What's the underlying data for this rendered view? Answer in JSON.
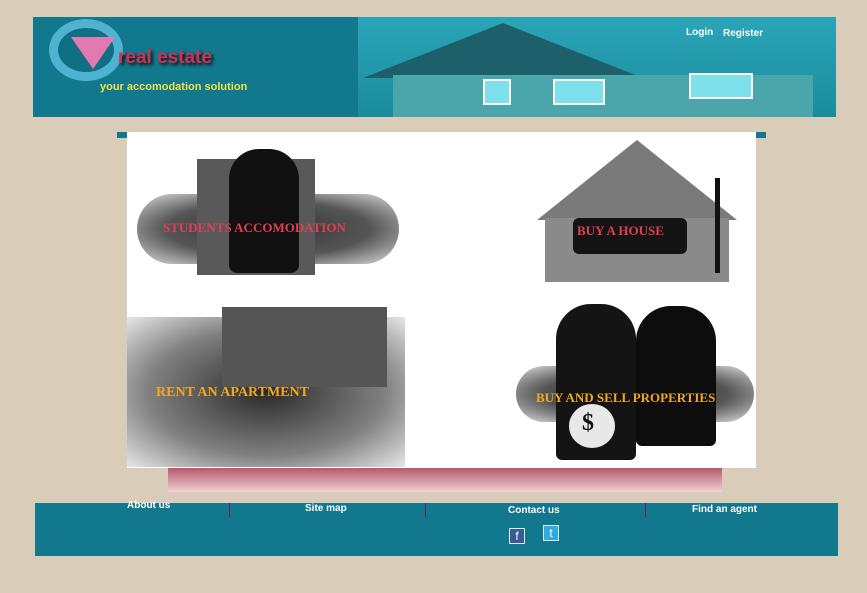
{
  "header": {
    "brand": "real estate",
    "tagline": "your accomodation solution",
    "login": "Login",
    "register": "Register"
  },
  "tiles": [
    {
      "label": "STUDENTS ACCOMODATION"
    },
    {
      "label": "BUY A HOUSE"
    },
    {
      "label": "RENT AN APARTMENT"
    },
    {
      "label": "BUY AND SELL PROPERTIES"
    }
  ],
  "footer": {
    "links": [
      "About us",
      "Site map",
      "Contact us",
      "Find an agent"
    ],
    "social": [
      {
        "icon": "facebook-icon",
        "glyph": "f"
      },
      {
        "icon": "twitter-icon",
        "glyph": "t"
      }
    ]
  },
  "colors": {
    "background": "#d9cdb9",
    "header": "#11788e",
    "brand": "#d23050",
    "tagline": "#f2e24a"
  }
}
